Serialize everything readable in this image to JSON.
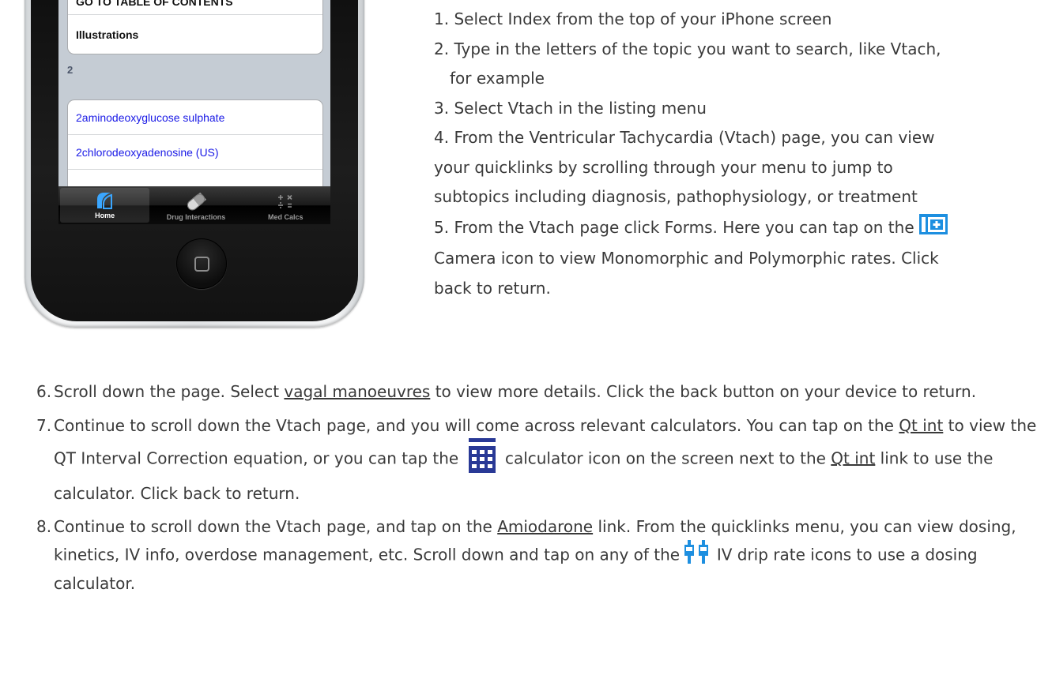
{
  "phone": {
    "screen_rows_top": [
      {
        "label": "GO TO TABLE OF CONTENTS"
      },
      {
        "label": "Illustrations"
      }
    ],
    "section_header": "2",
    "screen_rows_list": [
      {
        "label": "2aminodeoxyglucose sulphate"
      },
      {
        "label": "2chlorodeoxyadenosine (US)"
      }
    ],
    "tabs": [
      {
        "label": "Home",
        "icon": "home-icon",
        "active": true
      },
      {
        "label": "Drug Interactions",
        "icon": "pill-icon",
        "active": false
      },
      {
        "label": "Med Calcs",
        "icon": "calc-icon",
        "active": false
      }
    ]
  },
  "instructions": {
    "step1": "1. Select Index from the top of your iPhone screen",
    "step2a": "2. Type in the letters of the topic you want to search, like Vtach,",
    "step2b": "for example",
    "step3": "3. Select Vtach in the listing menu",
    "step4a": "4. From the Ventricular Tachycardia (Vtach) page, you can view",
    "step4b": "your quicklinks by scrolling through your menu to jump to",
    "step4c": "subtopics including diagnosis, pathophysiology, or treatment",
    "step5a": "5. From the Vtach page click Forms.  Here you can tap on the",
    "step5b": "Camera icon to  view Monomorphic and Polymorphic rates.  Click",
    "step5c": "back to return.",
    "step6": {
      "num": "6.",
      "pre": "Scroll down the page.  Select ",
      "link": "vagal manoeuvres",
      "post": " to view more details. Click the back button on your device to return."
    },
    "step7": {
      "num": "7.",
      "pre": "Continue to scroll down the Vtach page, and you will come across relevant calculators.  You can tap on the ",
      "link1": "Qt int",
      "mid": " to view the QT Interval Correction equation, or you can tap the ",
      "post_icon": " calculator icon on the screen next to the ",
      "link2": "Qt int",
      "post": " link to use the calculator.  Click back to return."
    },
    "step8": {
      "num": "8.",
      "pre": "Continue to scroll down the Vtach page, and tap on the ",
      "link": "Amiodarone",
      "mid": " link.  From the quicklinks menu, you can view dosing, kinetics, IV info, overdose management, etc. Scroll down and tap on any of the ",
      "post": " IV drip rate icons to use a dosing calculator."
    }
  },
  "icons": {
    "camera": "camera-icon",
    "calculator": "calculator-icon",
    "iv_drip": "iv-drip-icon"
  },
  "colors": {
    "link_blue": "#1a1ae6",
    "icon_blue": "#1d8fe0",
    "calc_navy": "#293996"
  }
}
